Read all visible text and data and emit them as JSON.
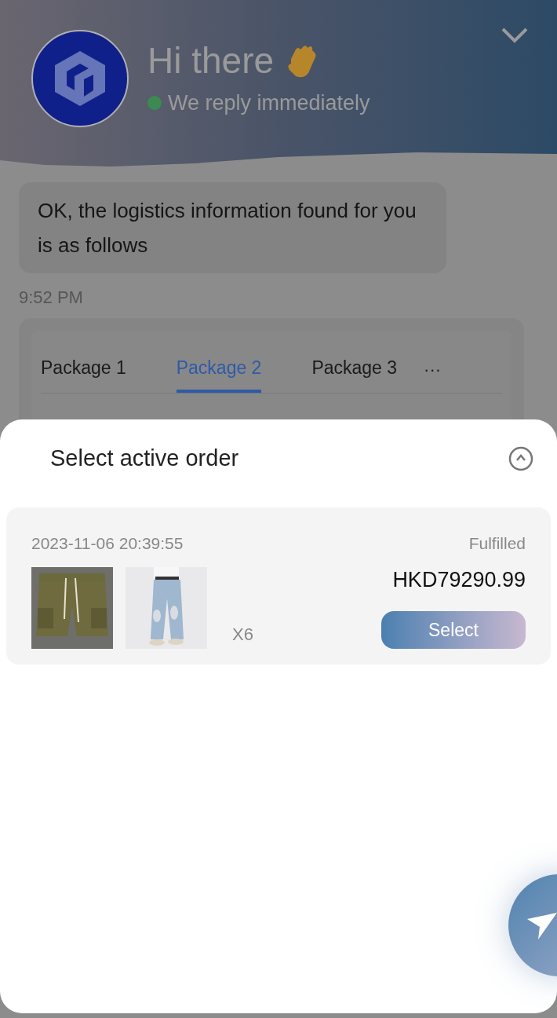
{
  "header": {
    "title": "Hi there",
    "status": {
      "text": "We reply immediately",
      "online": true
    }
  },
  "chat": {
    "message": "OK, the logistics information found for you is as follows",
    "time": "9:52 PM",
    "tabs": [
      {
        "label": "Package 1",
        "selected": false
      },
      {
        "label": "Package 2",
        "selected": true
      },
      {
        "label": "Package 3",
        "selected": false
      }
    ],
    "more": "···"
  },
  "sheet": {
    "title": "Select active order",
    "orders": [
      {
        "date": "2023-11-06 20:39:55",
        "status": "Fulfilled",
        "price": "HKD79290.99",
        "quantity": "X6",
        "button": "Select"
      }
    ]
  }
}
